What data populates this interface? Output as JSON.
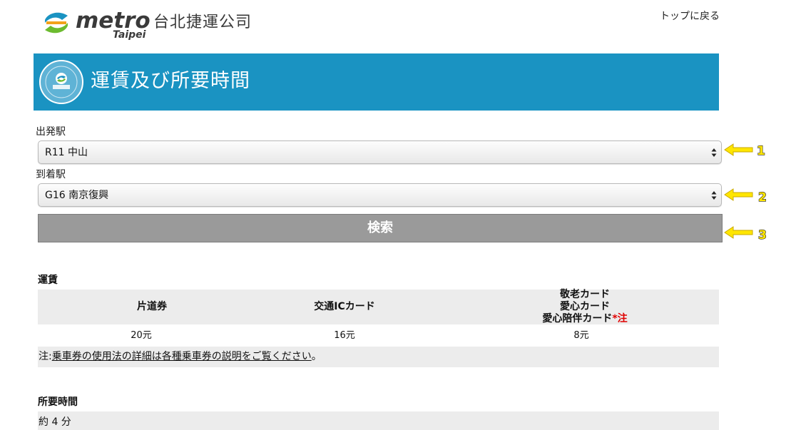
{
  "header": {
    "logo_metro": "metro",
    "logo_taipei": "Taipei",
    "logo_company": "台北捷運公司",
    "top_link": "トップに戻る"
  },
  "banner": {
    "title": "運賃及び所要時間"
  },
  "form": {
    "departure_label": "出発駅",
    "departure_value": "R11 中山",
    "arrival_label": "到着駅",
    "arrival_value": "G16 南京復興",
    "search_label": "検索"
  },
  "annotations": [
    "1",
    "2",
    "3"
  ],
  "fare": {
    "title": "運賃",
    "columns": [
      {
        "lines": [
          "片道券"
        ],
        "value": "20元"
      },
      {
        "lines": [
          "交通ICカード"
        ],
        "value": "16元"
      },
      {
        "lines": [
          "敬老カード",
          "愛心カード",
          "愛心陪伴カード"
        ],
        "marker": "*注",
        "value": "8元"
      }
    ],
    "note_prefix": "注:",
    "note_link": "乗車券の使用法の詳細は各種乗車券の説明をご覧ください",
    "note_suffix": "。"
  },
  "duration": {
    "title": "所要時間",
    "value": "約 4 分"
  },
  "colors": {
    "banner": "#1a93c2",
    "button": "#9a9a9a",
    "annotation_arrow": "#ffe600",
    "note_marker": "#e00000"
  }
}
